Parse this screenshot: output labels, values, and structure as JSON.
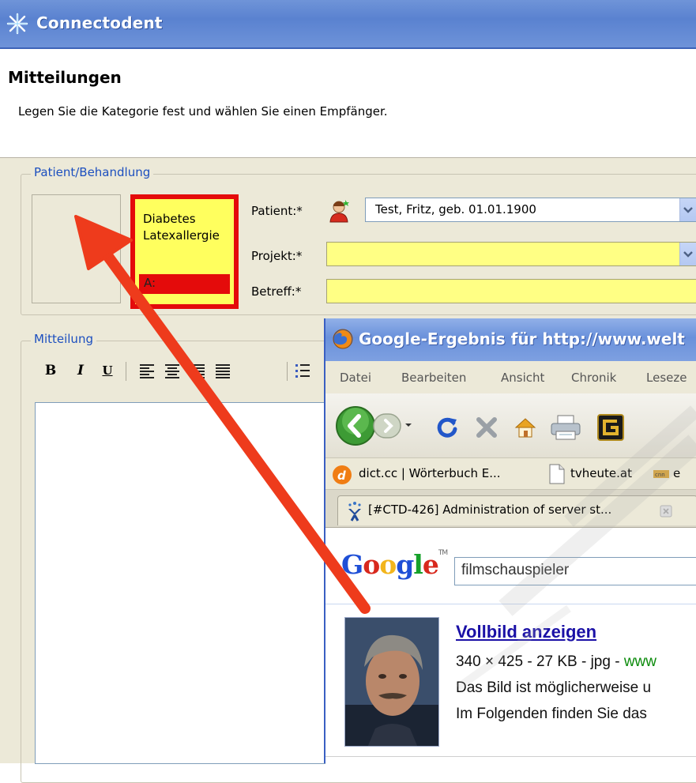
{
  "app": {
    "title": "Connectodent",
    "page_title": "Mitteilungen",
    "subtitle": "Legen Sie die Kategorie fest und wählen Sie einen Empfänger."
  },
  "patient_group": {
    "legend": "Patient/Behandlung",
    "alerts": [
      "Diabetes",
      "Latexallergie"
    ],
    "alert_bar_label": "A:",
    "patient_label": "Patient:*",
    "patient_value": "Test, Fritz, geb. 01.01.1900",
    "project_label": "Projekt:*",
    "project_value": "",
    "subject_label": "Betreff:*",
    "subject_value": ""
  },
  "message_group": {
    "legend": "Mitteilung",
    "toolbar": {
      "bold": "B",
      "italic": "I",
      "underline": "U"
    }
  },
  "browser": {
    "title": "Google-Ergebnis für http://www.welt",
    "menu": [
      "Datei",
      "Bearbeiten",
      "Ansicht",
      "Chronik",
      "Leseze"
    ],
    "bookmarks": [
      "dict.cc | Wörterbuch E...",
      "tvheute.at",
      "e"
    ],
    "tab_label": "[#CTD-426] Administration of server st...",
    "google_logo": "Google",
    "search_value": "filmschauspieler",
    "result": {
      "title": "Vollbild anzeigen",
      "meta": "340 × 425 - 27 KB - jpg - ",
      "meta_link": "www",
      "line2": "Das Bild ist möglicherweise u",
      "line3": "Im Folgenden finden Sie das"
    }
  },
  "colors": {
    "titlebar": "#5a82d0",
    "alert_border": "#e40b0b",
    "alert_bg": "#ffff5e",
    "required_field": "#ffff84",
    "arrow": "#ee3b1c",
    "google_blue": "#1a10a6"
  }
}
